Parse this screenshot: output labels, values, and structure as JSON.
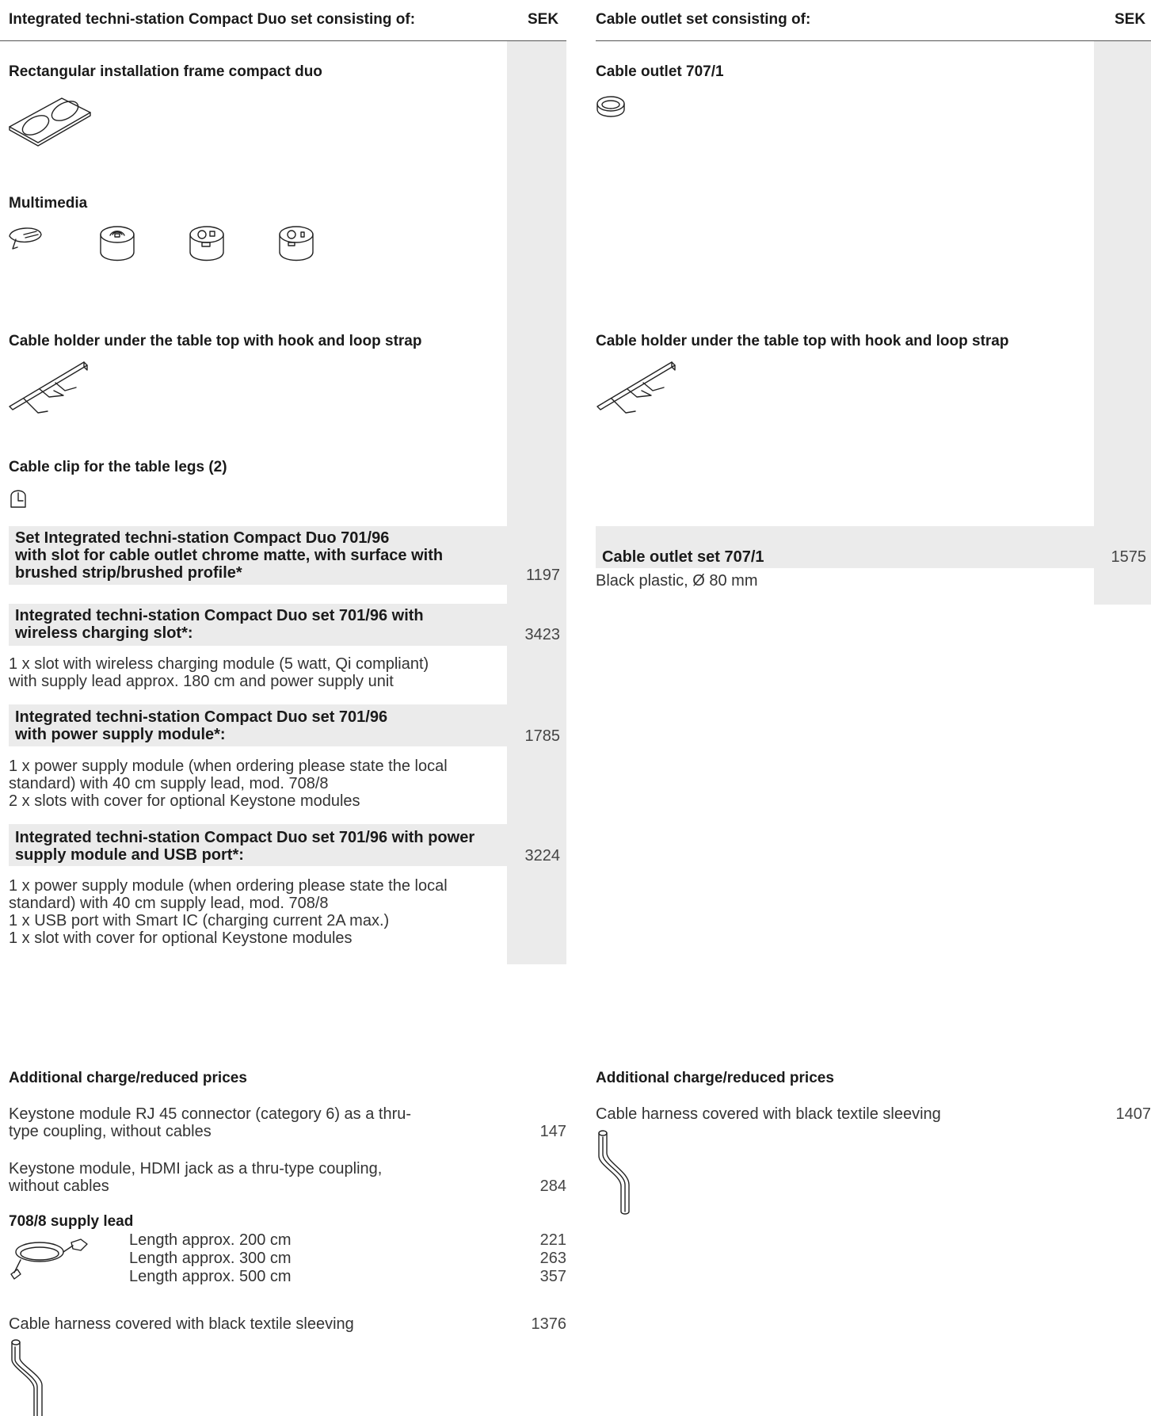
{
  "left": {
    "header": "Integrated techni-station Compact Duo set consisting of:",
    "currency": "SEK",
    "frame_title": "Rectangular installation frame compact duo",
    "multimedia_title": "Multimedia",
    "holder_title": "Cable holder under the table top with hook and loop strap",
    "clip_title": "Cable clip for the table legs (2)",
    "sets": [
      {
        "title": "Set Integrated techni-station Compact Duo 701/96\nwith slot for cable outlet chrome matte, with surface with\nbrushed strip/brushed profile*",
        "price": "1197",
        "desc": ""
      },
      {
        "title": "Integrated techni-station Compact Duo set 701/96 with\nwireless charging slot*:",
        "price": "3423",
        "desc": "1 x slot with wireless charging module (5 watt, Qi compliant)\nwith supply lead approx. 180 cm and power supply unit"
      },
      {
        "title": "Integrated techni-station Compact Duo set 701/96\nwith power supply module*:",
        "price": "1785",
        "desc": "1 x power supply module (when ordering please state the local\nstandard) with 40 cm supply lead, mod. 708/8\n2 x slots with cover for optional Keystone modules"
      },
      {
        "title": "Integrated techni-station Compact Duo set 701/96 with power\nsupply module and USB port*:",
        "price": "3224",
        "desc": "1 x power supply module (when ordering please state the local\nstandard) with 40 cm supply lead, mod. 708/8\n1 x USB port with Smart IC (charging current 2A max.)\n1 x slot with cover for optional Keystone modules"
      }
    ]
  },
  "right": {
    "header": "Cable outlet set consisting of:",
    "currency": "SEK",
    "outlet_title": "Cable outlet 707/1",
    "holder_title": "Cable holder under the table top with hook and loop strap",
    "set_title": "Cable outlet set 707/1",
    "set_price": "1575",
    "set_desc": "Black plastic, Ø 80 mm"
  },
  "additional_left": {
    "title": "Additional charge/reduced prices",
    "items": [
      {
        "text": "Keystone module RJ 45 connector (category 6) as a thru-\ntype coupling, without cables",
        "price": "147"
      },
      {
        "text": "Keystone module, HDMI jack as a thru-type coupling,\nwithout cables",
        "price": "284"
      }
    ],
    "lead_title": "708/8 supply lead",
    "lead_rows": [
      {
        "text": "Length approx. 200 cm",
        "price": "221"
      },
      {
        "text": "Length approx. 300 cm",
        "price": "263"
      },
      {
        "text": "Length approx. 500 cm",
        "price": "357"
      }
    ],
    "harness_text": "Cable harness covered with black textile sleeving",
    "harness_price": "1376"
  },
  "additional_right": {
    "title": "Additional charge/reduced prices",
    "harness_text": "Cable harness covered with black textile sleeving",
    "harness_price": "1407"
  }
}
